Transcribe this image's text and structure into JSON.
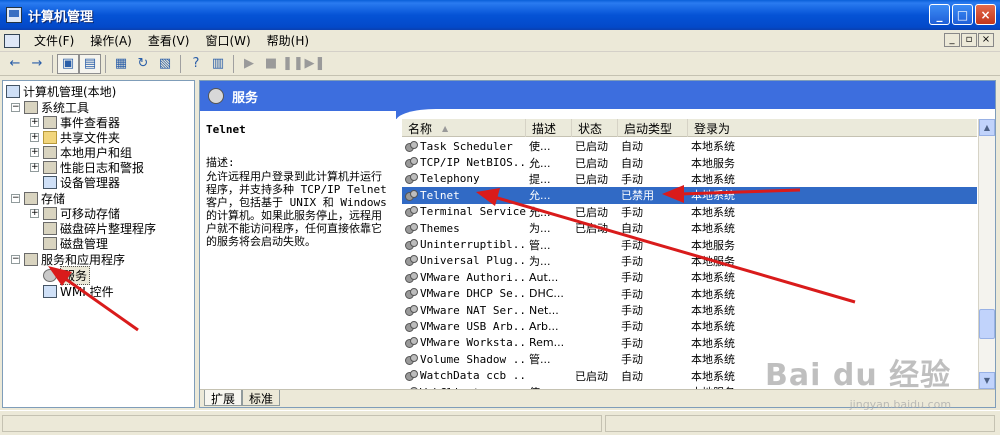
{
  "window": {
    "title": "计算机管理"
  },
  "menu": [
    "文件(F)",
    "操作(A)",
    "查看(V)",
    "窗口(W)",
    "帮助(H)"
  ],
  "mdi_buttons": [
    "_",
    "ð",
    "×"
  ],
  "tree": {
    "root": "计算机管理(本地)",
    "items": [
      {
        "label": "系统工具",
        "level": 1,
        "expander": "−"
      },
      {
        "label": "事件查看器",
        "level": 2,
        "expander": "+"
      },
      {
        "label": "共享文件夹",
        "level": 2,
        "expander": "+"
      },
      {
        "label": "本地用户和组",
        "level": 2,
        "expander": "+"
      },
      {
        "label": "性能日志和警报",
        "level": 2,
        "expander": "+"
      },
      {
        "label": "设备管理器",
        "level": 2,
        "expander": ""
      },
      {
        "label": "存储",
        "level": 1,
        "expander": "−"
      },
      {
        "label": "可移动存储",
        "level": 2,
        "expander": "+"
      },
      {
        "label": "磁盘碎片整理程序",
        "level": 2,
        "expander": ""
      },
      {
        "label": "磁盘管理",
        "level": 2,
        "expander": ""
      },
      {
        "label": "服务和应用程序",
        "level": 1,
        "expander": "−"
      },
      {
        "label": "服务",
        "level": 2,
        "expander": ""
      },
      {
        "label": "WMI 控件",
        "level": 2,
        "expander": ""
      }
    ]
  },
  "services_panel": {
    "header": "服务",
    "description": {
      "name": "Telnet",
      "label": "描述:",
      "text": "允许远程用户登录到此计算机并运行程序，并支持多种 TCP/IP Telnet 客户，包括基于 UNIX 和 Windows 的计算机。如果此服务停止，远程用户就不能访问程序，任何直接依靠它的服务将会启动失败。"
    },
    "columns": [
      "名称",
      "描述",
      "状态",
      "启动类型",
      "登录为"
    ],
    "rows": [
      {
        "name": "Task Scheduler",
        "desc": "使...",
        "status": "已启动",
        "startup": "自动",
        "logon": "本地系统"
      },
      {
        "name": "TCP/IP NetBIOS...",
        "desc": "允...",
        "status": "已启动",
        "startup": "自动",
        "logon": "本地服务"
      },
      {
        "name": "Telephony",
        "desc": "提...",
        "status": "已启动",
        "startup": "手动",
        "logon": "本地系统"
      },
      {
        "name": "Telnet",
        "desc": "允...",
        "status": "",
        "startup": "已禁用",
        "logon": "本地系统"
      },
      {
        "name": "Terminal Services",
        "desc": "允...",
        "status": "已启动",
        "startup": "手动",
        "logon": "本地系统"
      },
      {
        "name": "Themes",
        "desc": "为...",
        "status": "已启动",
        "startup": "自动",
        "logon": "本地系统"
      },
      {
        "name": "Uninterruptibl...",
        "desc": "管...",
        "status": "",
        "startup": "手动",
        "logon": "本地服务"
      },
      {
        "name": "Universal Plug...",
        "desc": "为...",
        "status": "",
        "startup": "手动",
        "logon": "本地服务"
      },
      {
        "name": "VMware Authori...",
        "desc": "Aut...",
        "status": "",
        "startup": "手动",
        "logon": "本地系统"
      },
      {
        "name": "VMware DHCP Se...",
        "desc": "DHC...",
        "status": "",
        "startup": "手动",
        "logon": "本地系统"
      },
      {
        "name": "VMware NAT Ser...",
        "desc": "Net...",
        "status": "",
        "startup": "手动",
        "logon": "本地系统"
      },
      {
        "name": "VMware USB Arb...",
        "desc": "Arb...",
        "status": "",
        "startup": "手动",
        "logon": "本地系统"
      },
      {
        "name": "VMware Worksta...",
        "desc": "Rem...",
        "status": "",
        "startup": "手动",
        "logon": "本地系统"
      },
      {
        "name": "Volume Shadow ...",
        "desc": "管...",
        "status": "",
        "startup": "手动",
        "logon": "本地系统"
      },
      {
        "name": "WatchData ccb ...",
        "desc": "",
        "status": "已启动",
        "startup": "自动",
        "logon": "本地系统"
      },
      {
        "name": "WebClient",
        "desc": "使...",
        "status": "",
        "startup": "",
        "logon": "本地服务"
      }
    ],
    "selected_row": 3,
    "tabs": [
      "扩展",
      "标准"
    ]
  },
  "watermark": {
    "logo": "Bai du 经验",
    "url": "jingyan.baidu.com"
  },
  "colors": {
    "titlebar": "#0553d6",
    "selection": "#316ac5",
    "annotation": "#d91b1b"
  }
}
